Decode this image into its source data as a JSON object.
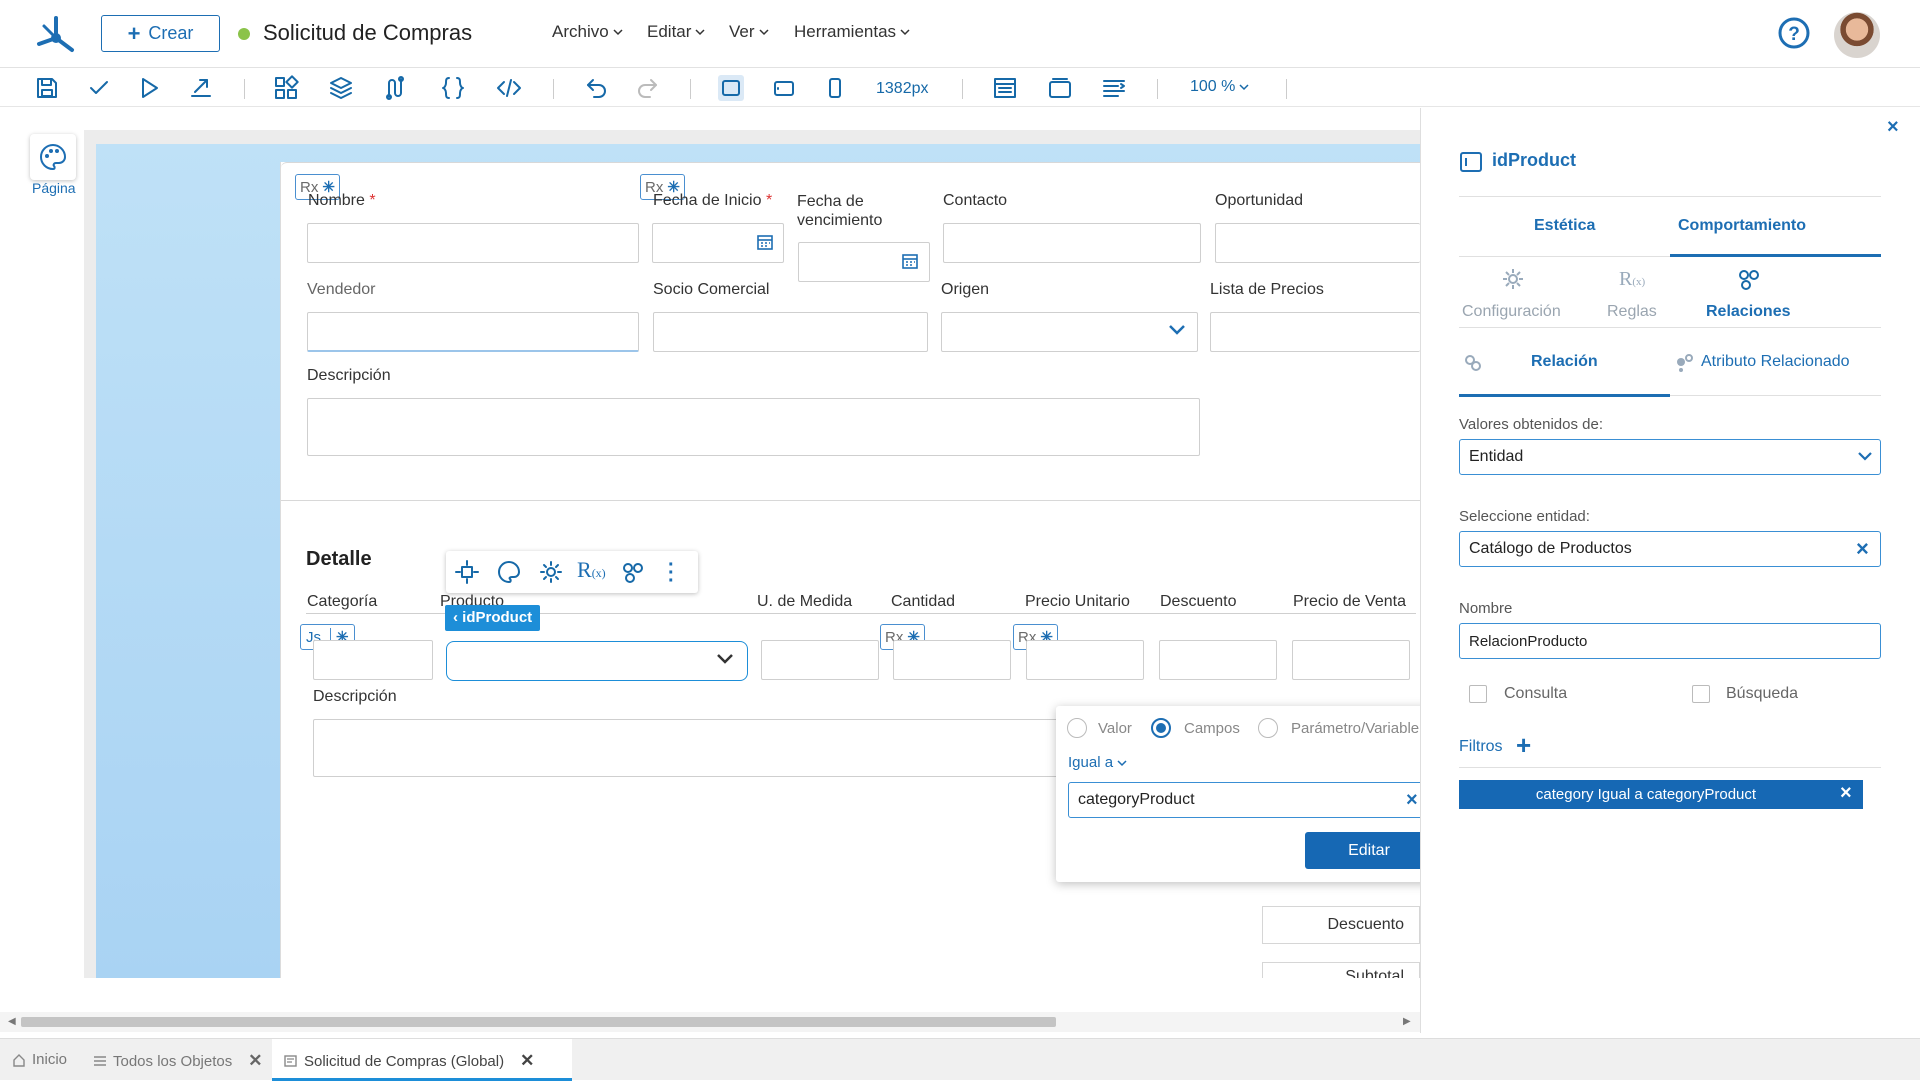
{
  "header": {
    "create_label": "Crear",
    "doc_title": "Solicitud de Compras",
    "menus": [
      {
        "label": "Archivo"
      },
      {
        "label": "Editar"
      },
      {
        "label": "Ver"
      },
      {
        "label": "Herramientas"
      }
    ]
  },
  "toolbar": {
    "width_value": "1382px",
    "zoom_value": "100 %"
  },
  "left_rail": {
    "page_label": "Página"
  },
  "form": {
    "fields": {
      "nombre": "Nombre",
      "fecha_inicio": "Fecha de Inicio",
      "fecha_venc_1": "Fecha de",
      "fecha_venc_2": "vencimiento",
      "contacto": "Contacto",
      "oportunidad": "Oportunidad",
      "vendedor": "Vendedor",
      "socio": "Socio Comercial",
      "origen": "Origen",
      "lista_precios": "Lista de Precios",
      "descripcion": "Descripción"
    },
    "required_mark": "*",
    "rx": "Rx",
    "js": "Js",
    "star": "✳"
  },
  "detail": {
    "title": "Detalle",
    "columns": [
      "Categoría",
      "Producto",
      "U. de Medida",
      "Cantidad",
      "Precio Unitario",
      "Descuento",
      "Precio de Venta"
    ],
    "selected_badge": "idProduct",
    "row_desc_label": "Descripción",
    "totals": [
      "Descuento",
      "Subtotal"
    ]
  },
  "popup": {
    "radio_valor": "Valor",
    "radio_campos": "Campos",
    "radio_param": "Parámetro/Variable",
    "operator": "Igual a",
    "field_value": "categoryProduct",
    "edit_button": "Editar"
  },
  "panel": {
    "title": "idProduct",
    "tabs": [
      "Estética",
      "Comportamiento"
    ],
    "subtabs": [
      "Configuración",
      "Reglas",
      "Relaciones"
    ],
    "relation_tabs": [
      "Relación",
      "Atributo Relacionado"
    ],
    "values_from_label": "Valores obtenidos de:",
    "values_from": "Entidad",
    "entity_label": "Seleccione entidad:",
    "entity": "Catálogo de Productos",
    "name_label": "Nombre",
    "name_value": "RelacionProducto",
    "check_consulta": "Consulta",
    "check_busqueda": "Búsqueda",
    "filters_label": "Filtros",
    "filter_chip": "category Igual a categoryProduct"
  },
  "bottom_tabs": [
    {
      "label": "Inicio"
    },
    {
      "label": "Todos los Objetos"
    },
    {
      "label": "Solicitud de Compras (Global)"
    }
  ],
  "colors": {
    "accent": "#1d6eb3",
    "chip": "#1668b4",
    "status_dot": "#8bc34a"
  }
}
